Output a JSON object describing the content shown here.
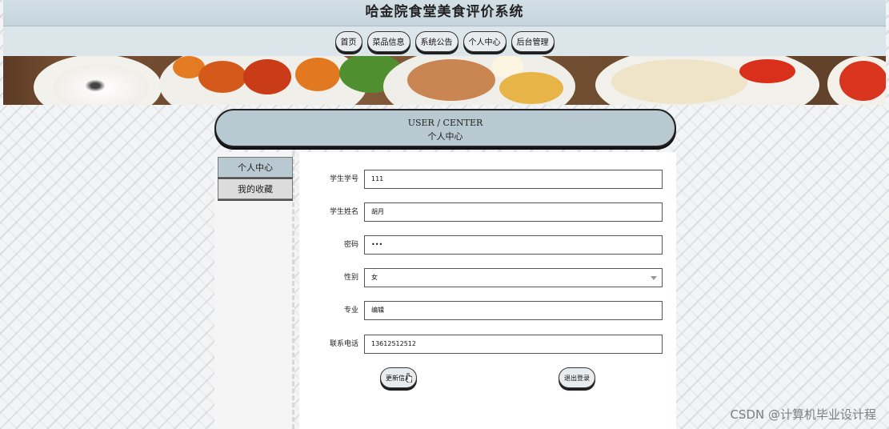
{
  "header": {
    "title": "哈金院食堂美食评价系统"
  },
  "nav": {
    "items": [
      "首页",
      "菜品信息",
      "系统公告",
      "个人中心",
      "后台管理"
    ]
  },
  "center_header": {
    "en": "USER / CENTER",
    "cn": "个人中心"
  },
  "sidebar": {
    "items": [
      "个人中心",
      "我的收藏"
    ]
  },
  "form": {
    "fields": [
      {
        "label": "学生学号",
        "value": "111"
      },
      {
        "label": "学生姓名",
        "value": "胡月"
      },
      {
        "label": "密码",
        "value": "•••"
      },
      {
        "label": "性别",
        "value": "女"
      },
      {
        "label": "专业",
        "value": "编辑"
      },
      {
        "label": "联系电话",
        "value": "13612512512"
      }
    ],
    "update_button": "更新信息",
    "logout_button": "退出登录"
  },
  "watermark": "CSDN @计算机毕业设计程",
  "colors": {
    "accent": "#b8c9d1",
    "title_bar": "#c9d8e0"
  }
}
